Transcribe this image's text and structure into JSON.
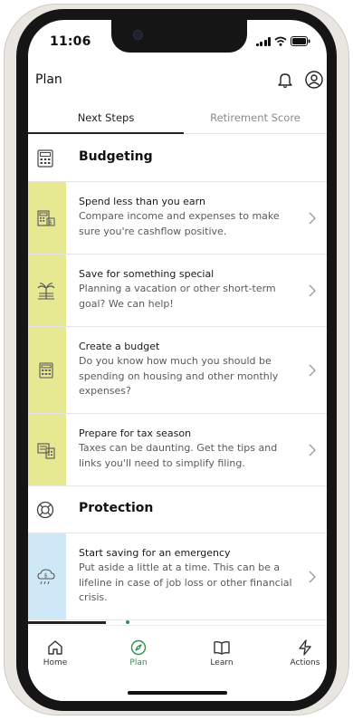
{
  "status_bar": {
    "time": "11:06"
  },
  "header": {
    "title": "Plan"
  },
  "tabs": [
    {
      "label": "Next Steps",
      "active": true
    },
    {
      "label": "Retirement Score",
      "active": false
    }
  ],
  "sections": [
    {
      "title": "Budgeting",
      "icon": "calculator-icon",
      "accent": "#e6e892",
      "cards": [
        {
          "title": "Spend less than you earn",
          "desc": [
            "Compare income and expenses to make",
            "sure you're cashflow positive."
          ],
          "icon": "money-calculator-icon"
        },
        {
          "title": "Save for something special",
          "desc": [
            "Planning a vacation or other short-term",
            "goal? We can help!"
          ],
          "icon": "palm-tree-icon"
        },
        {
          "title": "Create a budget",
          "desc": [
            "Do you know how much you should be",
            "spending on housing and other monthly",
            "expenses?"
          ],
          "icon": "budget-calculator-icon"
        },
        {
          "title": "Prepare for tax season",
          "desc": [
            "Taxes can be daunting. Get the tips and",
            "links you'll need to simplify filing."
          ],
          "icon": "tax-document-icon"
        }
      ]
    },
    {
      "title": "Protection",
      "icon": "life-ring-icon",
      "accent": "#cfe8f7",
      "cards": [
        {
          "title": "Start saving for an emergency",
          "desc": [
            "Put aside a little at a time. This can be a",
            "lifeline in case of job loss or other financial",
            "crisis."
          ],
          "icon": "rainy-day-money-icon"
        }
      ]
    }
  ],
  "bottom_nav": [
    {
      "label": "Home",
      "icon": "home-icon",
      "active": false
    },
    {
      "label": "Plan",
      "icon": "compass-icon",
      "active": true
    },
    {
      "label": "Learn",
      "icon": "book-icon",
      "active": false
    },
    {
      "label": "Actions",
      "icon": "lightning-icon",
      "active": false
    }
  ],
  "colors": {
    "active_nav": "#2f8f4f",
    "budgeting_accent": "#e6e892",
    "protection_accent": "#cfe8f7"
  }
}
